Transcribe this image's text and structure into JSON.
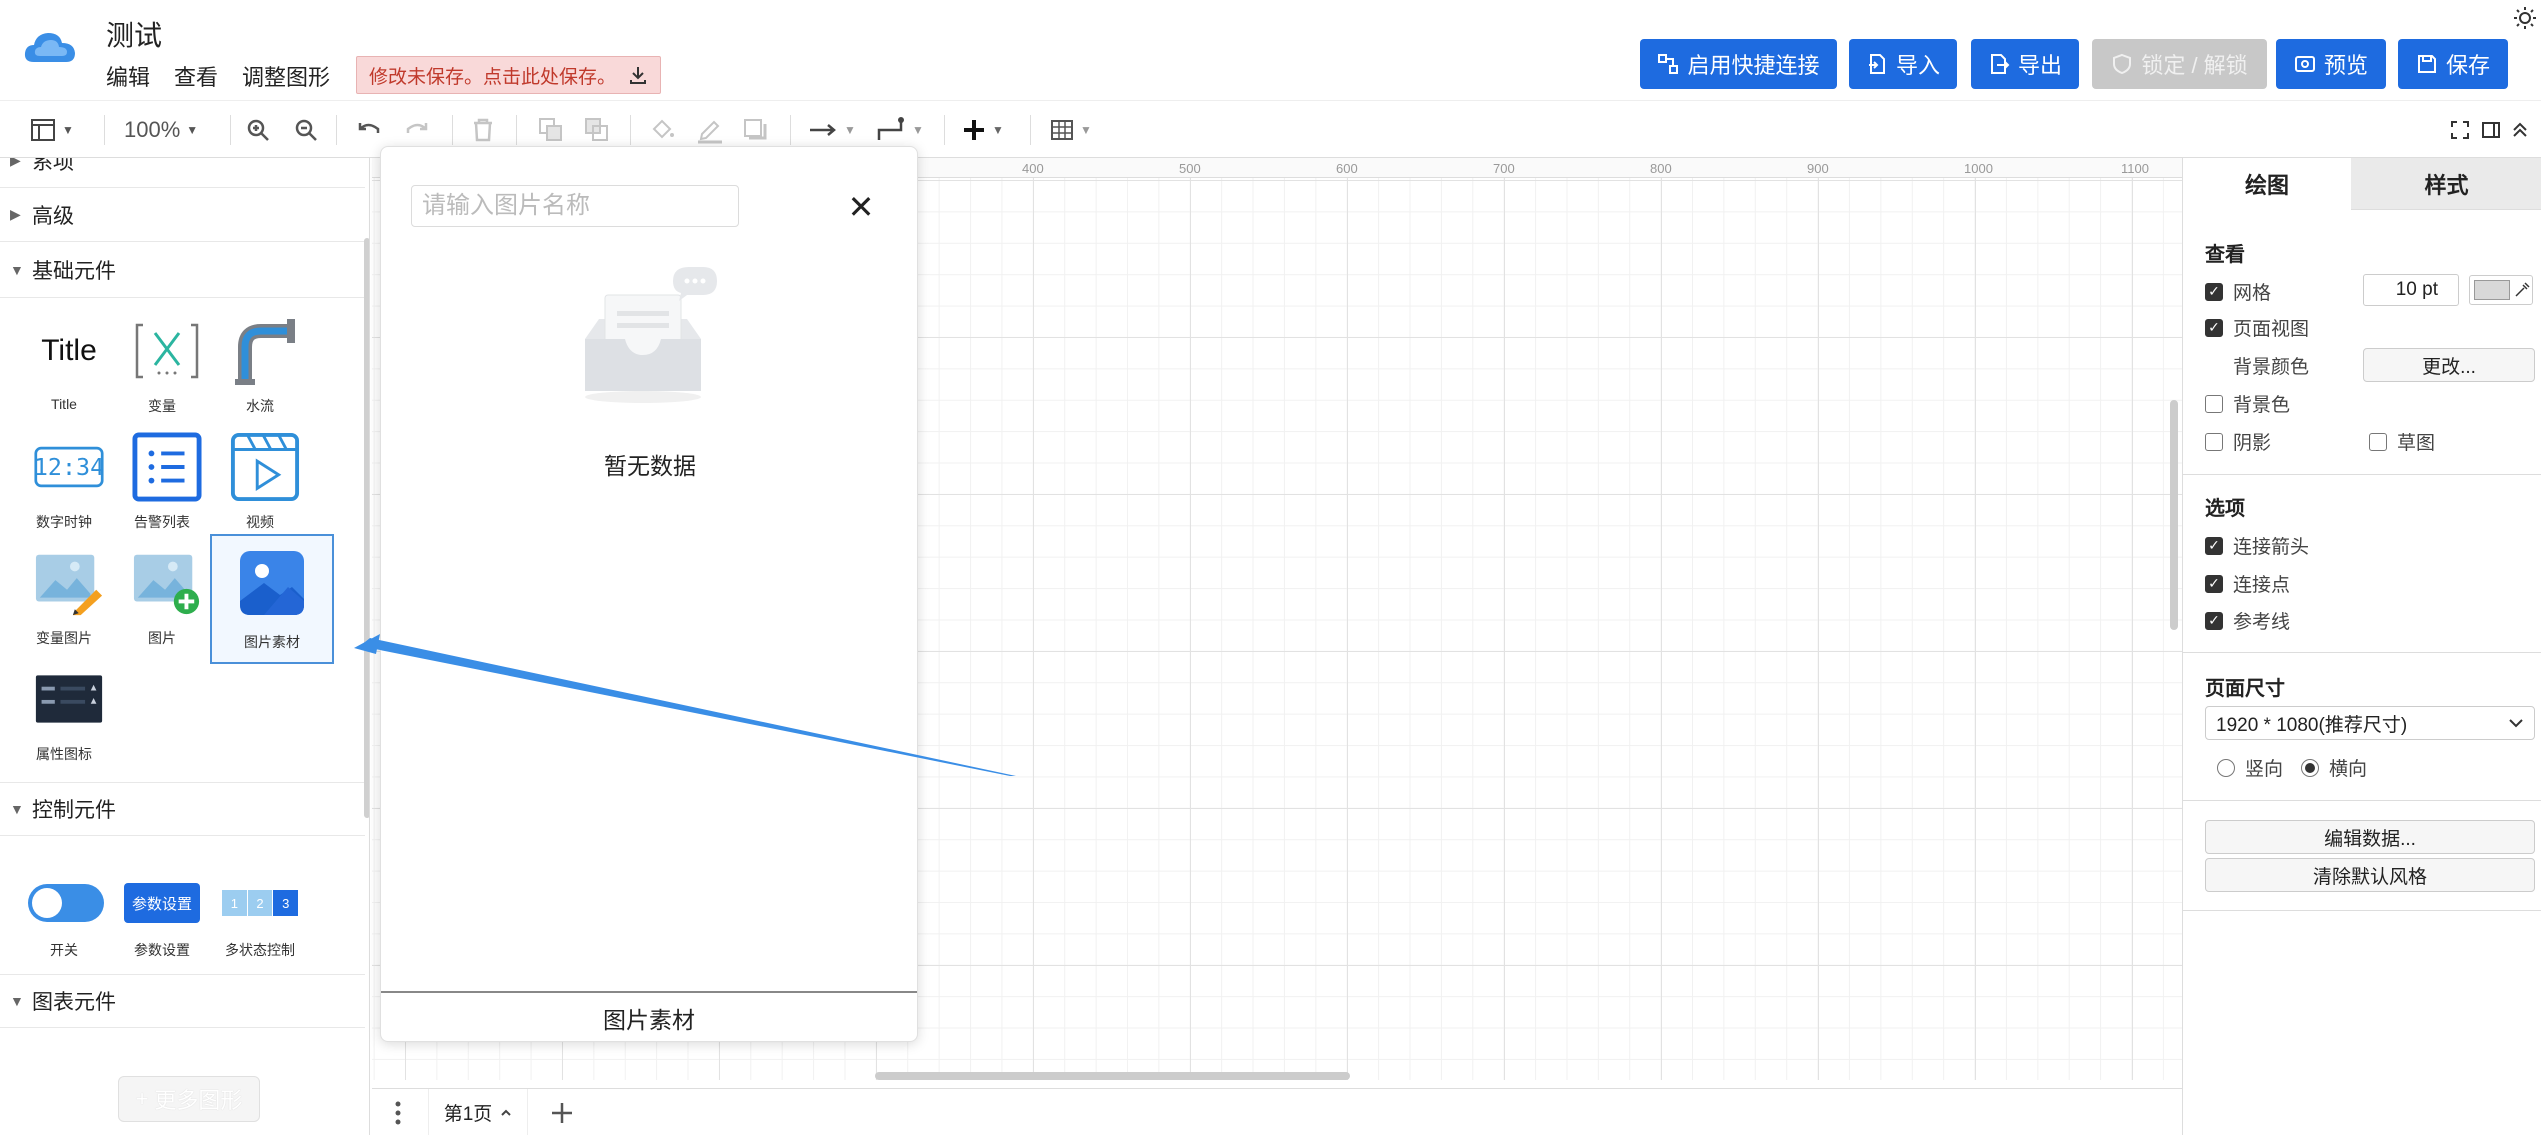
{
  "header": {
    "title": "测试",
    "menu": [
      "编辑",
      "查看",
      "调整图形"
    ],
    "unsaved_notice": "修改未保存。点击此处保存。",
    "buttons": {
      "quick_connect": "启用快捷连接",
      "import": "导入",
      "export": "导出",
      "lock": "锁定 / 解锁",
      "preview": "预览",
      "save": "保存"
    }
  },
  "toolbar": {
    "zoom": "100%"
  },
  "sidebar": {
    "sections": {
      "partial_top": "系项",
      "advanced": "高级",
      "basic": "基础元件",
      "control": "控制元件",
      "chart": "图表元件"
    },
    "basic_shapes": {
      "title_icon_text": "Title",
      "title": "Title",
      "variable": "变量",
      "water_flow": "水流",
      "digital_clock": "数字时钟",
      "clock_text": "12:34",
      "alarm_list": "告警列表",
      "video": "视频",
      "variable_image": "变量图片",
      "image": "图片",
      "image_asset": "图片素材",
      "property_icon": "属性图标"
    },
    "control_shapes": {
      "switch": "开关",
      "param_btn_text": "参数设置",
      "param_settings": "参数设置",
      "multi_state": "多状态控制",
      "multi_state_steps": [
        "1",
        "2",
        "3"
      ]
    },
    "more_shapes": "更多图形"
  },
  "ruler": {
    "labels": [
      "400",
      "500",
      "600",
      "700",
      "800",
      "900",
      "1000",
      "1100"
    ]
  },
  "popup": {
    "search_placeholder": "请输入图片名称",
    "empty_text": "暂无数据",
    "footer": "图片素材"
  },
  "right_panel": {
    "tabs": [
      "绘图",
      "样式"
    ],
    "view_title": "查看",
    "grid": "网格",
    "grid_size": "10 pt",
    "page_view": "页面视图",
    "bg_color_label": "背景颜色",
    "change_btn": "更改...",
    "bg_color_check": "背景色",
    "shadow": "阴影",
    "sketch": "草图",
    "options_title": "选项",
    "connect_arrows": "连接箭头",
    "connect_points": "连接点",
    "guides": "参考线",
    "page_size_title": "页面尺寸",
    "page_size_value": "1920 * 1080(推荐尺寸)",
    "portrait": "竖向",
    "landscape": "横向",
    "edit_data": "编辑数据...",
    "clear_style": "清除默认风格"
  },
  "pagebar": {
    "page_name": "第1页"
  }
}
